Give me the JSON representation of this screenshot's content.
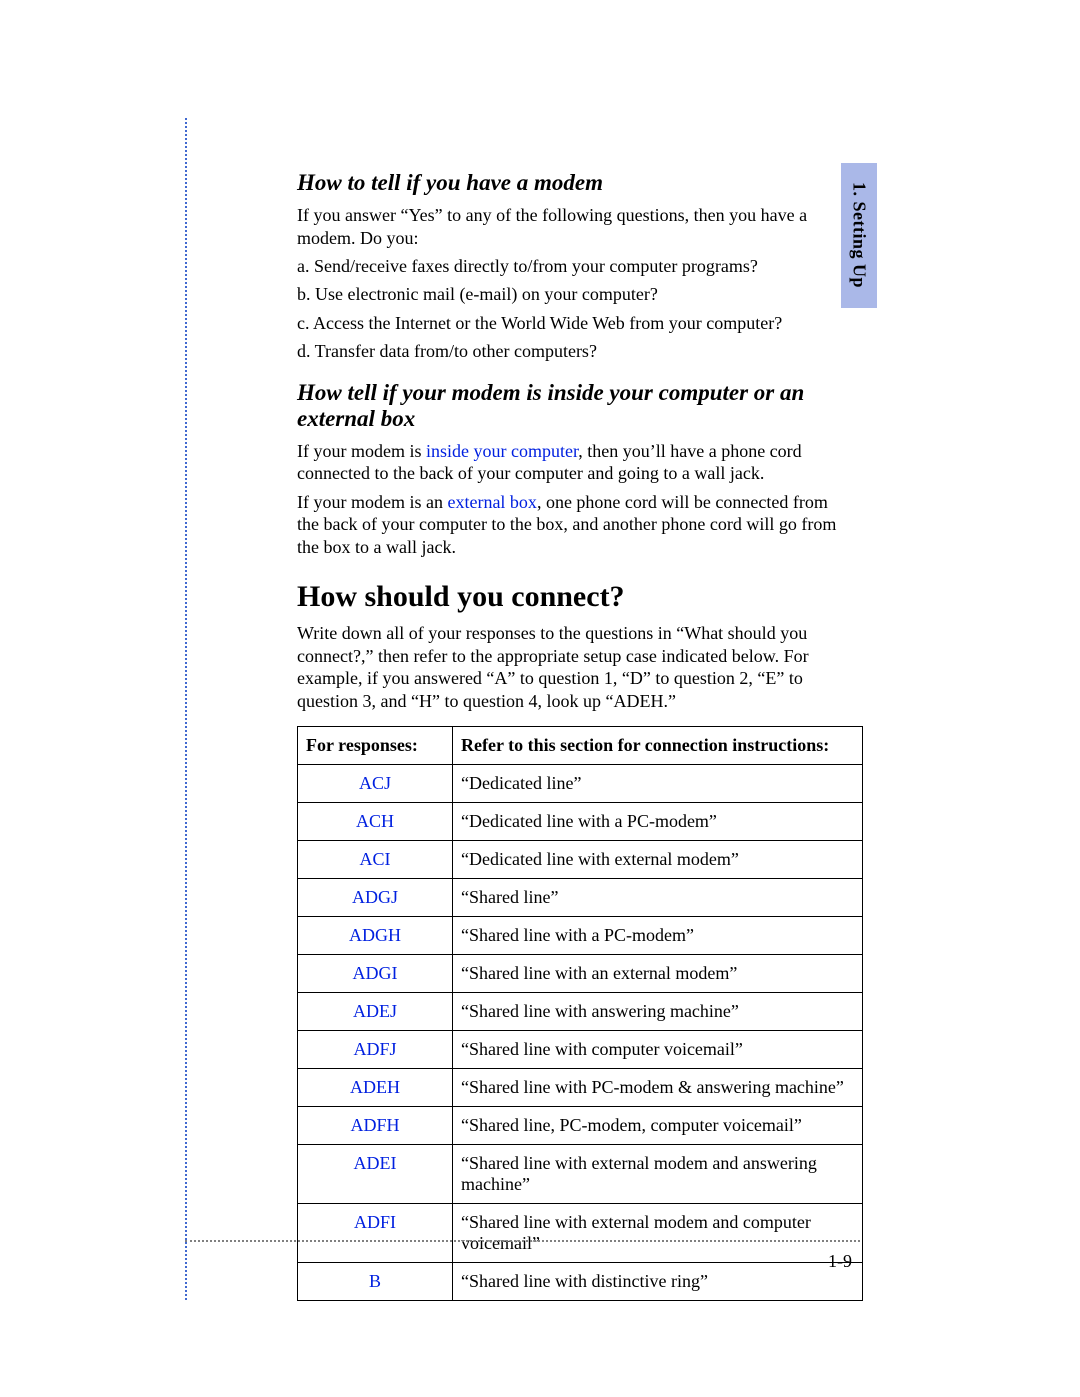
{
  "sideTab": "1. Setting Up",
  "section1": {
    "heading": "How to tell if you have a modem",
    "intro": "If you answer “Yes” to any of the following questions, then you have a modem. Do you:",
    "items": [
      "a. Send/receive faxes directly to/from your computer programs?",
      "b. Use electronic mail (e-mail) on your computer?",
      "c. Access the Internet or the World Wide Web from your computer?",
      "d. Transfer data from/to other computers?"
    ]
  },
  "section2": {
    "heading": "How tell if your modem is inside your computer or an external box",
    "p1a": "If your modem is ",
    "link1": "inside your computer",
    "p1b": ", then you’ll have a phone cord connected to the back of your computer and going to a wall jack.",
    "p2a": "If your modem is an ",
    "link2": "external box",
    "p2b": ", one phone cord will be connected from the back of your computer to the box, and another phone cord will go from the box to a wall jack."
  },
  "section3": {
    "heading": "How should you connect?",
    "intro": "Write down all of your responses to the questions in “What should you connect?,” then refer to the appropriate setup case indicated below. For example, if you answered “A” to question 1, “D” to question 2, “E” to question 3, and “H” to question 4, look up “ADEH.”"
  },
  "table": {
    "header1": "For responses:",
    "header2": "Refer to this section for connection instructions:",
    "rows": [
      {
        "code": "ACJ",
        "desc": "“Dedicated line”"
      },
      {
        "code": "ACH",
        "desc": "“Dedicated line with a PC-modem”"
      },
      {
        "code": "ACI",
        "desc": "“Dedicated line with external modem”"
      },
      {
        "code": "ADGJ",
        "desc": "“Shared line”"
      },
      {
        "code": "ADGH",
        "desc": "“Shared line with a PC-modem”"
      },
      {
        "code": "ADGI",
        "desc": "“Shared line with an external modem”"
      },
      {
        "code": "ADEJ",
        "desc": "“Shared line with answering machine”"
      },
      {
        "code": "ADFJ",
        "desc": "“Shared line with computer voicemail”"
      },
      {
        "code": "ADEH",
        "desc": "“Shared line with PC-modem & answering machine”"
      },
      {
        "code": "ADFH",
        "desc": "“Shared line, PC-modem, computer voicemail”"
      },
      {
        "code": "ADEI",
        "desc": "“Shared line with external modem and answering machine”"
      },
      {
        "code": "ADFI",
        "desc": "“Shared line with external modem and computer voicemail”"
      },
      {
        "code": "B",
        "desc": "“Shared line with distinctive ring”"
      }
    ]
  },
  "pageNumber": "1-9"
}
